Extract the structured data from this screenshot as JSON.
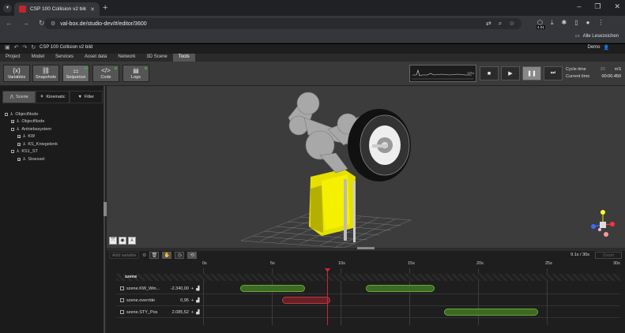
{
  "browser": {
    "tab_title": "CSP 100 Collision v2 bild",
    "url": "val-box.de/studio-dev/#/editor/3600",
    "bookmarks_label": "Alle Lesezeichen",
    "new_tab": "+",
    "ext_badge": "4.01"
  },
  "app": {
    "doc_title": "CSP 100 Collision v2 bild",
    "user": "Demo",
    "menu": [
      "Project",
      "Model",
      "Services",
      "Asset data",
      "Network",
      "3D Scene",
      "Tools"
    ],
    "active_menu": "Tools"
  },
  "toolbar": {
    "buttons": [
      {
        "icon": "{x}",
        "label": "Variables"
      },
      {
        "icon": "⛓",
        "label": "Snapshots"
      },
      {
        "icon": "⚏",
        "label": "Sequence"
      },
      {
        "icon": "</>",
        "label": "Code"
      },
      {
        "icon": "▤",
        "label": "Logs"
      }
    ],
    "graph_unit": "CPU",
    "cycle_time_label": "Cycle time",
    "cycle_time_value": "30",
    "cycle_time_unit": "mS",
    "current_time_label": "Current time",
    "current_time_value": "00:00.450"
  },
  "left": {
    "tabs": [
      "Scene",
      "Kinematic",
      "Filter"
    ],
    "tree": [
      {
        "label": "ObjectNode",
        "level": 0
      },
      {
        "label": "ObjectNode",
        "level": 1
      },
      {
        "label": "Antriebssystem",
        "level": 1
      },
      {
        "label": "KW",
        "level": 2
      },
      {
        "label": "KS_Kniegelenk",
        "level": 2
      },
      {
        "label": "KS1_ST",
        "level": 1
      },
      {
        "label": "Stoessel",
        "level": 2
      }
    ]
  },
  "timeline": {
    "add_variable_placeholder": "Add variable",
    "range": "9.1s / 30s",
    "zoom_label": "Zoom",
    "ticks": [
      "0s",
      "5s",
      "10s",
      "15s",
      "20s",
      "25s",
      "30s"
    ],
    "group": "szene",
    "rows": [
      {
        "name": "szene.KW_Win...",
        "value": "-2.340,00"
      },
      {
        "name": "szene.override",
        "value": "0,95"
      },
      {
        "name": "szene.STY_Pos",
        "value": "2.085,52"
      }
    ]
  }
}
